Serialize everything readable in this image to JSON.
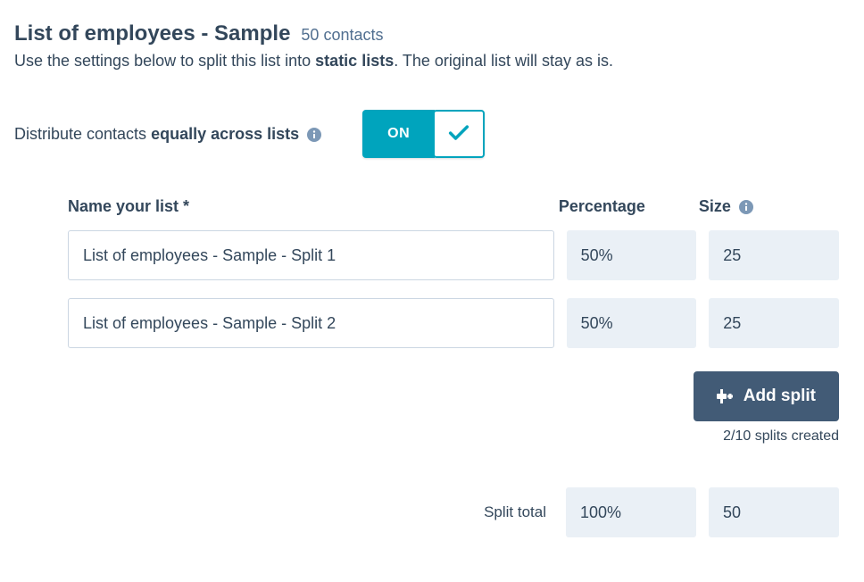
{
  "header": {
    "title": "List of employees - Sample",
    "contacts_text": "50 contacts",
    "subtitle_before": "Use the settings below to split this list into ",
    "subtitle_bold": "static lists",
    "subtitle_after": ". The original list will stay as is."
  },
  "distribute": {
    "label_before": "Distribute contacts ",
    "label_bold": "equally across lists",
    "toggle_state": "ON"
  },
  "columns": {
    "name_label": "Name your list *",
    "percentage_label": "Percentage",
    "size_label": "Size"
  },
  "splits": [
    {
      "name": "List of employees - Sample - Split 1",
      "percentage": "50%",
      "size": "25"
    },
    {
      "name": "List of employees - Sample - Split 2",
      "percentage": "50%",
      "size": "25"
    }
  ],
  "add_split": {
    "button_label": "Add split",
    "count_text": "2/10 splits created"
  },
  "totals": {
    "label": "Split total",
    "percentage": "100%",
    "size": "50"
  }
}
